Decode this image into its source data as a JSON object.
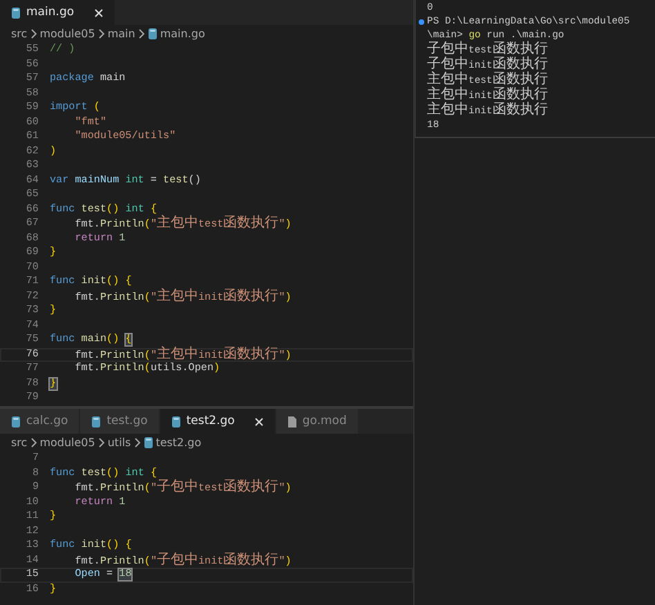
{
  "top_editor": {
    "tabs": [
      {
        "label": "main.go",
        "kind": "go",
        "selected": true
      }
    ],
    "breadcrumb": [
      {
        "label": "src",
        "kind": "folder"
      },
      {
        "label": "module05",
        "kind": "folder"
      },
      {
        "label": "main",
        "kind": "folder"
      },
      {
        "label": "main.go",
        "kind": "go"
      }
    ],
    "lines": [
      {
        "number": "55",
        "tokens": [
          {
            "kind": "comment",
            "text": "// )"
          }
        ]
      },
      {
        "number": "56"
      },
      {
        "number": "57",
        "tokens": [
          {
            "kind": "kw",
            "text": "package"
          },
          {
            "kind": "plain",
            "text": " main"
          }
        ]
      },
      {
        "number": "58"
      },
      {
        "number": "59",
        "tokens": [
          {
            "kind": "kw",
            "text": "import"
          },
          {
            "kind": "brace",
            "text": " ("
          }
        ]
      },
      {
        "number": "60",
        "tokens": [
          {
            "kind": "str",
            "text": "    \"fmt\""
          }
        ]
      },
      {
        "number": "61",
        "tokens": [
          {
            "kind": "str",
            "text": "    \"module05/utils\""
          }
        ]
      },
      {
        "number": "62",
        "tokens": [
          {
            "kind": "brace",
            "text": ")"
          }
        ]
      },
      {
        "number": "63"
      },
      {
        "number": "64",
        "tokens": [
          {
            "kind": "kw",
            "text": "var"
          },
          {
            "kind": "var",
            "text": " mainNum"
          },
          {
            "kind": "type",
            "text": " int"
          },
          {
            "kind": "plain",
            "text": " = "
          },
          {
            "kind": "fn",
            "text": "test"
          },
          {
            "kind": "plain",
            "text": "()"
          }
        ]
      },
      {
        "number": "65"
      },
      {
        "number": "66",
        "tokens": [
          {
            "kind": "kw",
            "text": "func"
          },
          {
            "kind": "fn",
            "text": " test"
          },
          {
            "kind": "brace",
            "text": "()"
          },
          {
            "kind": "type",
            "text": " int"
          },
          {
            "kind": "brace",
            "text": " {"
          }
        ]
      },
      {
        "number": "67",
        "tokens": [
          {
            "kind": "plain",
            "text": "    fmt."
          },
          {
            "kind": "fn",
            "text": "Println"
          },
          {
            "kind": "brace",
            "text": "("
          },
          {
            "kind": "str",
            "text": "\"主包中test函数执行\""
          },
          {
            "kind": "brace",
            "text": ")"
          }
        ]
      },
      {
        "number": "68",
        "tokens": [
          {
            "kind": "ctl",
            "text": "    return"
          },
          {
            "kind": "num",
            "text": " 1"
          }
        ]
      },
      {
        "number": "69",
        "tokens": [
          {
            "kind": "brace",
            "text": "}"
          }
        ]
      },
      {
        "number": "70"
      },
      {
        "number": "71",
        "tokens": [
          {
            "kind": "kw",
            "text": "func"
          },
          {
            "kind": "fn",
            "text": " init"
          },
          {
            "kind": "brace",
            "text": "() {"
          }
        ]
      },
      {
        "number": "72",
        "tokens": [
          {
            "kind": "plain",
            "text": "    fmt."
          },
          {
            "kind": "fn",
            "text": "Println"
          },
          {
            "kind": "brace",
            "text": "("
          },
          {
            "kind": "str",
            "text": "\"主包中init函数执行\""
          },
          {
            "kind": "brace",
            "text": ")"
          }
        ]
      },
      {
        "number": "73",
        "tokens": [
          {
            "kind": "brace",
            "text": "}"
          }
        ]
      },
      {
        "number": "74"
      },
      {
        "number": "75",
        "tokens": [
          {
            "kind": "kw",
            "text": "func"
          },
          {
            "kind": "fn",
            "text": " main"
          },
          {
            "kind": "brace",
            "text": "() "
          },
          {
            "kind": "brace",
            "text": "{",
            "matched": true
          }
        ]
      },
      {
        "number": "76",
        "current": true,
        "tokens": [
          {
            "kind": "plain",
            "text": "    fmt."
          },
          {
            "kind": "fn",
            "text": "Println"
          },
          {
            "kind": "brace",
            "text": "("
          },
          {
            "kind": "str",
            "text": "\"主包中init函数执行\""
          },
          {
            "kind": "brace",
            "text": ")"
          }
        ]
      },
      {
        "number": "77",
        "tokens": [
          {
            "kind": "plain",
            "text": "    fmt."
          },
          {
            "kind": "fn",
            "text": "Println"
          },
          {
            "kind": "brace",
            "text": "("
          },
          {
            "kind": "plain",
            "text": "utils.Open"
          },
          {
            "kind": "brace",
            "text": ")"
          }
        ]
      },
      {
        "number": "78",
        "tokens": [
          {
            "kind": "brace",
            "text": "}",
            "matched": true
          }
        ]
      },
      {
        "number": "79"
      }
    ]
  },
  "terminal": {
    "lines": [
      {
        "kind": "output",
        "text": "0"
      },
      {
        "kind": "prompt",
        "text": "PS D:\\LearningData\\Go\\src\\module05"
      },
      {
        "kind": "command",
        "text": "\\main>",
        "program": "go",
        "args": "run .\\main.go"
      },
      {
        "kind": "output",
        "text": "子包中test函数执行"
      },
      {
        "kind": "output",
        "text": "子包中init函数执行"
      },
      {
        "kind": "output",
        "text": "主包中test函数执行"
      },
      {
        "kind": "output",
        "text": "主包中init函数执行"
      },
      {
        "kind": "output",
        "text": "主包中init函数执行"
      },
      {
        "kind": "output",
        "text": "18"
      }
    ]
  },
  "bottom_editor": {
    "tabs": [
      {
        "label": "calc.go",
        "kind": "go",
        "selected": false
      },
      {
        "label": "test.go",
        "kind": "go",
        "selected": false
      },
      {
        "label": "test2.go",
        "kind": "go",
        "selected": true
      },
      {
        "label": "go.mod",
        "kind": "mod",
        "selected": false
      }
    ],
    "breadcrumb": [
      {
        "label": "src",
        "kind": "folder"
      },
      {
        "label": "module05",
        "kind": "folder"
      },
      {
        "label": "utils",
        "kind": "folder"
      },
      {
        "label": "test2.go",
        "kind": "go"
      }
    ],
    "lines": [
      {
        "number": "7"
      },
      {
        "number": "8",
        "tokens": [
          {
            "kind": "kw",
            "text": "func"
          },
          {
            "kind": "fn",
            "text": " test"
          },
          {
            "kind": "brace",
            "text": "()"
          },
          {
            "kind": "type",
            "text": " int"
          },
          {
            "kind": "brace",
            "text": " {"
          }
        ]
      },
      {
        "number": "9",
        "tokens": [
          {
            "kind": "plain",
            "text": "    fmt."
          },
          {
            "kind": "fn",
            "text": "Println"
          },
          {
            "kind": "brace",
            "text": "("
          },
          {
            "kind": "str",
            "text": "\"子包中test函数执行\""
          },
          {
            "kind": "brace",
            "text": ")"
          }
        ]
      },
      {
        "number": "10",
        "tokens": [
          {
            "kind": "ctl",
            "text": "    return"
          },
          {
            "kind": "num",
            "text": " 1"
          }
        ]
      },
      {
        "number": "11",
        "tokens": [
          {
            "kind": "brace",
            "text": "}"
          }
        ]
      },
      {
        "number": "12"
      },
      {
        "number": "13",
        "tokens": [
          {
            "kind": "kw",
            "text": "func"
          },
          {
            "kind": "fn",
            "text": " init"
          },
          {
            "kind": "brace",
            "text": "() {"
          }
        ]
      },
      {
        "number": "14",
        "tokens": [
          {
            "kind": "plain",
            "text": "    fmt."
          },
          {
            "kind": "fn",
            "text": "Println"
          },
          {
            "kind": "brace",
            "text": "("
          },
          {
            "kind": "str",
            "text": "\"子包中init函数执行\""
          },
          {
            "kind": "brace",
            "text": ")"
          }
        ]
      },
      {
        "number": "15",
        "current": true,
        "tokens": [
          {
            "kind": "var",
            "text": "    Open"
          },
          {
            "kind": "plain",
            "text": " = "
          },
          {
            "kind": "num",
            "text": "18",
            "matched": true
          }
        ]
      },
      {
        "number": "16",
        "tokens": [
          {
            "kind": "brace",
            "text": "}"
          }
        ]
      }
    ]
  }
}
